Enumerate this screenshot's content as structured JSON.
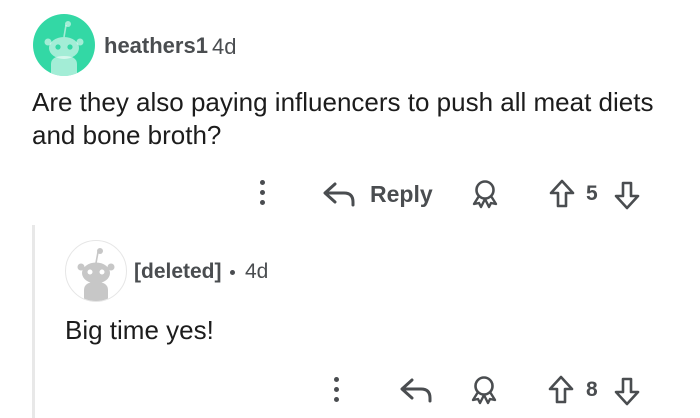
{
  "comment": {
    "username": "heathers1",
    "age": "4d",
    "body": "Are they also paying influencers to push all meat diets and bone broth?",
    "actions": {
      "more_icon": "kebab-vertical-icon",
      "reply_icon": "reply-arrow-icon",
      "reply_label": "Reply",
      "award_icon": "award-icon",
      "upvote_icon": "upvote-arrow-icon",
      "vote_count": "5",
      "downvote_icon": "downvote-arrow-icon"
    },
    "avatar_color": "#33d8a5"
  },
  "reply": {
    "username": "[deleted]",
    "age": "4d",
    "body": "Big time yes!",
    "actions": {
      "more_icon": "kebab-vertical-icon",
      "reply_icon": "reply-arrow-icon",
      "award_icon": "award-icon",
      "upvote_icon": "upvote-arrow-icon",
      "vote_count": "8",
      "downvote_icon": "downvote-arrow-icon"
    },
    "avatar_color": "#ffffff"
  },
  "colors": {
    "meta_text": "#4a4d50",
    "body_text": "#1c1c1c",
    "thread_line": "#e8e8e8"
  }
}
